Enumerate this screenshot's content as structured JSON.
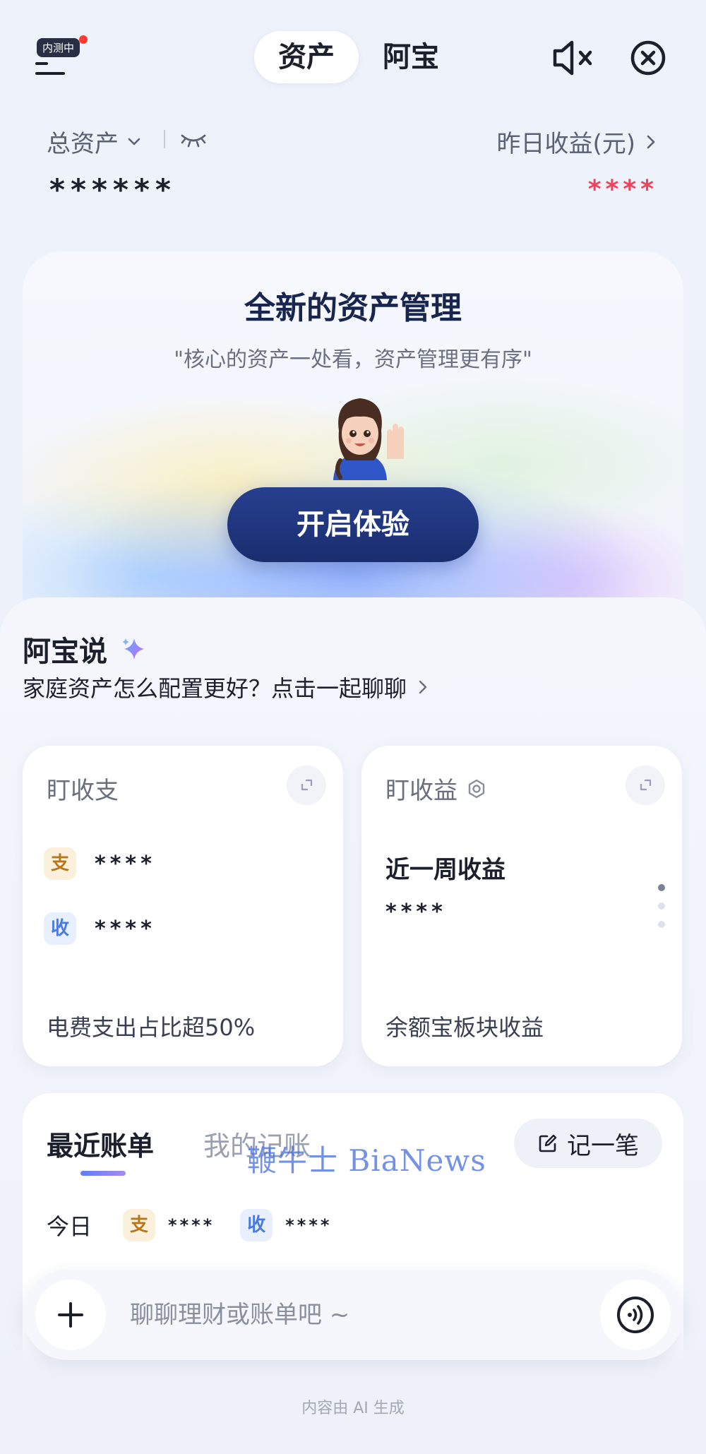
{
  "header": {
    "beta_badge": "内测中",
    "tabs": [
      {
        "label": "资产",
        "active": true
      },
      {
        "label": "阿宝",
        "active": false
      }
    ],
    "icons": [
      "menu-icon",
      "mute-icon",
      "close-icon"
    ]
  },
  "summary": {
    "total_label": "总资产",
    "total_value": "******",
    "yesterday_label": "昨日收益(元)",
    "yesterday_value": "****",
    "yesterday_color": "#f0435a"
  },
  "promo": {
    "title": "全新的资产管理",
    "subtitle": "\"核心的资产一处看，资产管理更有序\"",
    "button_label": "开启体验"
  },
  "abao": {
    "title": "阿宝说",
    "prompt": "家庭资产怎么配置更好？点击一起聊聊"
  },
  "cards": {
    "income_expense": {
      "title": "盯收支",
      "expense_tag": "支",
      "expense_value": "****",
      "income_tag": "收",
      "income_value": "****",
      "footer": "电费支出占比超50%"
    },
    "earnings": {
      "title": "盯收益",
      "week_label": "近一周收益",
      "week_value": "****",
      "footer": "余额宝板块收益",
      "page_indicator": {
        "current": 1,
        "total": 3
      }
    }
  },
  "bills": {
    "tabs": [
      {
        "label": "最近账单",
        "active": true
      },
      {
        "label": "我的记账",
        "active": false
      }
    ],
    "note_button": "记一笔",
    "watermark": "鞭牛士 BiaNews",
    "today_label": "今日",
    "expense_tag": "支",
    "expense_value": "****",
    "income_tag": "收",
    "income_value": "****"
  },
  "composer": {
    "placeholder": "聊聊理财或账单吧 ~"
  },
  "footer_note": "内容由 AI 生成",
  "colors": {
    "primary_button": "#1f3680",
    "accent_red": "#f0435a",
    "tab_gradient_start": "#5f7cf5",
    "tab_gradient_end": "#a58cf2"
  }
}
